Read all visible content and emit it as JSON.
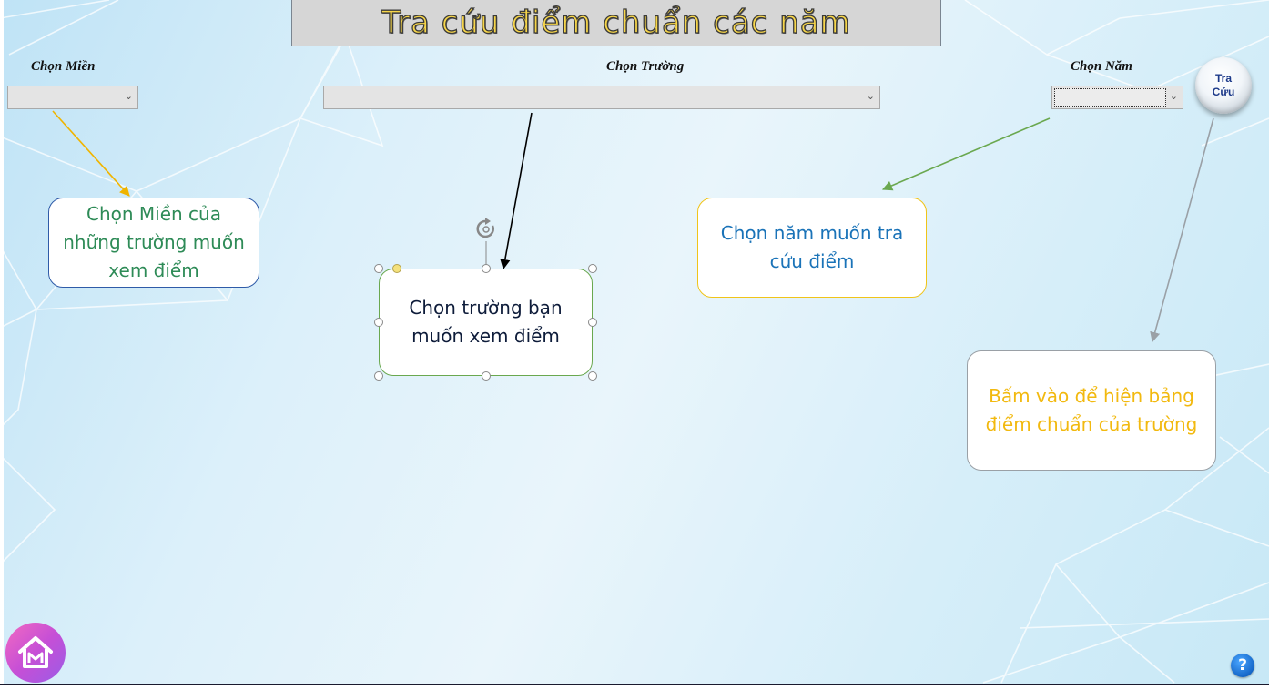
{
  "header": {
    "title": "Tra cứu điểm chuẩn các năm"
  },
  "form": {
    "region_label": "Chọn Miền",
    "school_label": "Chọn Trường",
    "year_label": "Chọn Năm",
    "region_value": "",
    "school_value": "",
    "year_value": ""
  },
  "search_button": {
    "line1": "Tra",
    "line2": "Cứu"
  },
  "callouts": {
    "region": "Chọn Miền của những trường muốn xem điểm",
    "school": "Chọn trường bạn muốn xem điểm",
    "year": "Chọn năm muốn tra cứu điểm",
    "search": "Bấm vào để hiện bảng điểm chuẩn của trường"
  },
  "footer": {
    "help_label": "?"
  },
  "icons": {
    "dropdown": "chevron-down-icon",
    "home": "home-icon",
    "help": "help-icon",
    "rotate": "rotate-handle-icon"
  },
  "colors": {
    "title_fill": "#f7d64a",
    "region_callout_text": "#2e8b57",
    "year_callout_text": "#1a73b8",
    "search_callout_text": "#f2b90f",
    "region_arrow": "#f0b400",
    "year_arrow": "#6aa84f",
    "search_arrow": "#9aa0a6"
  }
}
